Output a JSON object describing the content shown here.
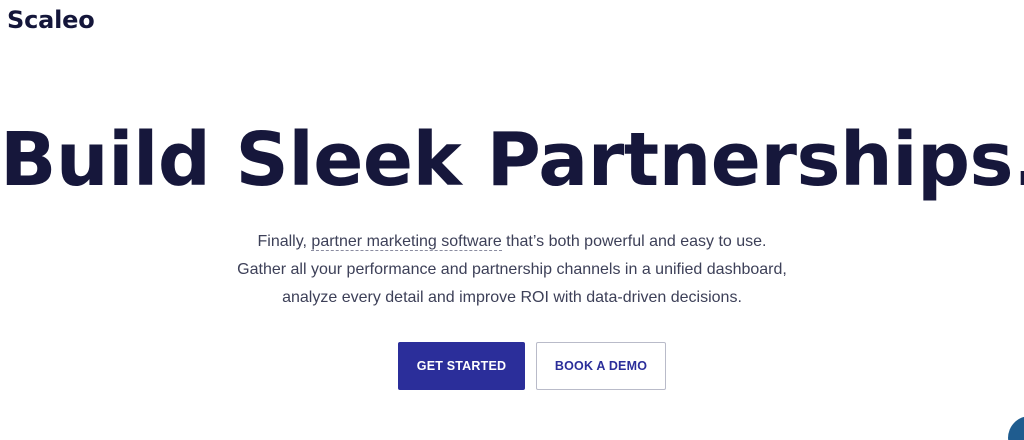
{
  "header": {
    "logo_text": "Scaleo"
  },
  "hero": {
    "title": "Build Sleek Partnerships.",
    "subtitle": {
      "line1_prefix": "Finally, ",
      "line1_link": "partner marketing software",
      "line1_suffix": " that’s both powerful and easy to use.",
      "line2": "Gather all your performance and partnership channels in a unified dashboard,",
      "line3": "analyze every detail and improve ROI with data-driven decisions."
    },
    "buttons": {
      "primary_label": "GET STARTED",
      "secondary_label": "BOOK A DEMO"
    }
  },
  "colors": {
    "heading": "#16173b",
    "body_text": "#3d4058",
    "primary_button_bg": "#2b2e9a",
    "secondary_button_border": "#b9bbc9",
    "chat_widget": "#1f5c8f"
  },
  "icons": {
    "chat_widget": "chat-bubble-icon"
  }
}
